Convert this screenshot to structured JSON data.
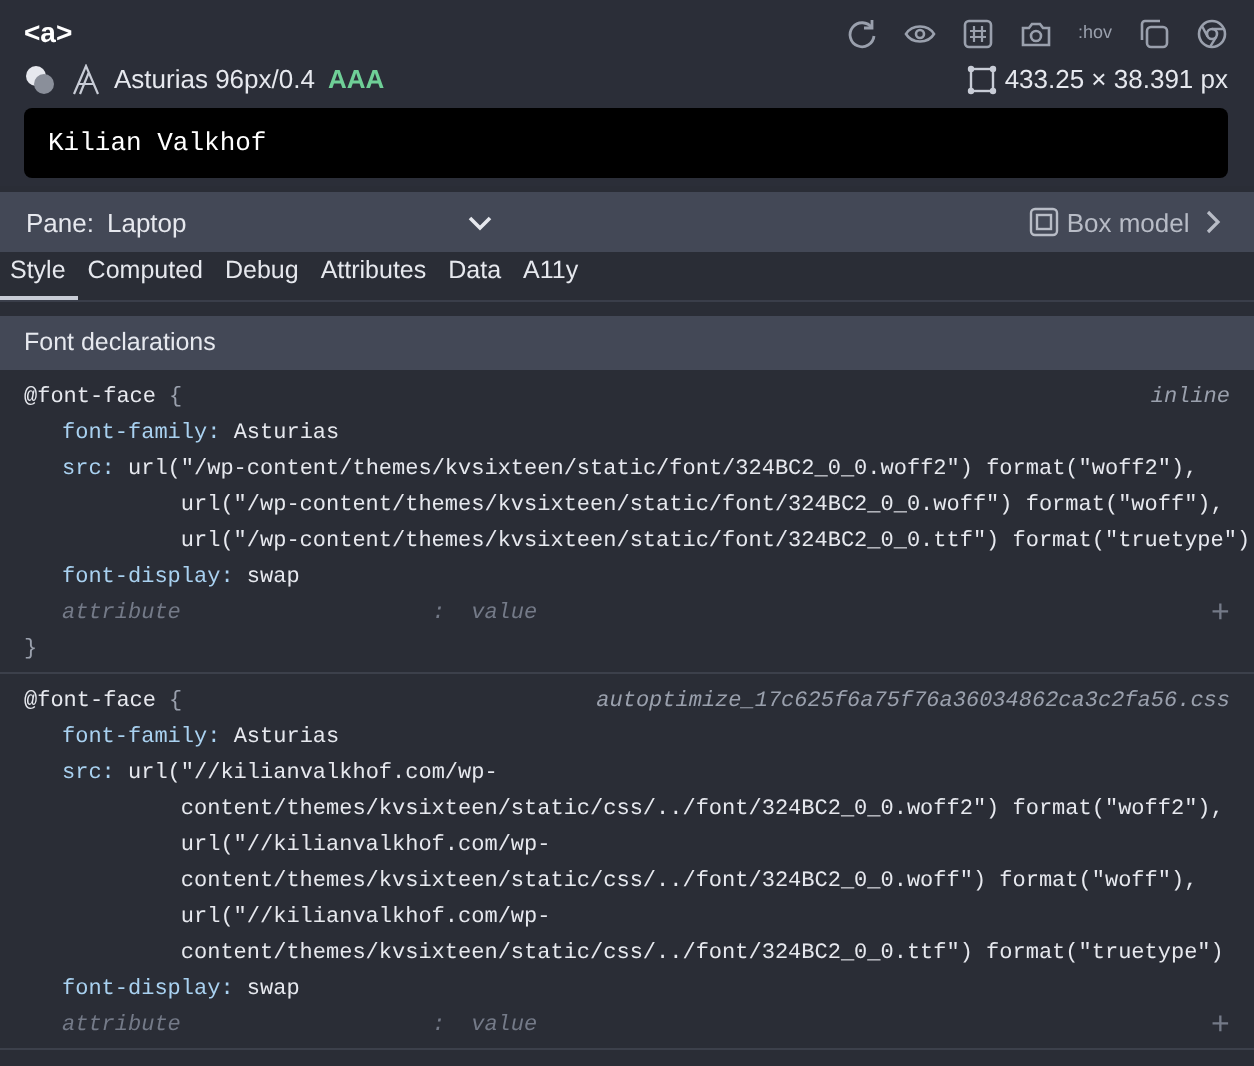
{
  "element": {
    "tag": "<a>",
    "font": "Asturias 96px/0.4",
    "contrast": "AAA",
    "size": "433.25 × 38.391 px",
    "preview": "Kilian Valkhof"
  },
  "toolbar": [
    {
      "kind": "refresh"
    },
    {
      "kind": "eye"
    },
    {
      "kind": "hash"
    },
    {
      "kind": "camera"
    },
    {
      "kind": "text",
      "label": ":hov"
    },
    {
      "kind": "copy"
    },
    {
      "kind": "chrome"
    }
  ],
  "pane": {
    "label": "Pane:",
    "value": "Laptop",
    "box_model": "Box model"
  },
  "tabs": [
    {
      "label": "Style",
      "selected": true
    },
    {
      "label": "Computed",
      "selected": false
    },
    {
      "label": "Debug",
      "selected": false
    },
    {
      "label": "Attributes",
      "selected": false
    },
    {
      "label": "Data",
      "selected": false
    },
    {
      "label": "A11y",
      "selected": false
    }
  ],
  "section": "Font declarations",
  "rules": [
    {
      "selector": "@font-face",
      "brace_open": "{",
      "source": "inline",
      "declarations": [
        {
          "property": "font-family:",
          "value_lines": [
            "Asturias"
          ]
        },
        {
          "property": "src:",
          "value_lines": [
            "url(\"/wp-content/themes/kvsixteen/static/font/324BC2_0_0.woff2\") format(\"woff2\"),",
            "url(\"/wp-content/themes/kvsixteen/static/font/324BC2_0_0.woff\") format(\"woff\"),",
            "url(\"/wp-content/themes/kvsixteen/static/font/324BC2_0_0.ttf\") format(\"truetype\")"
          ]
        },
        {
          "property": "font-display:",
          "value_lines": [
            "swap"
          ]
        }
      ],
      "new_attribute": {
        "placeholder": "attribute",
        "separator": ":",
        "value_placeholder": "value",
        "plus": "+"
      },
      "brace_close": "}"
    },
    {
      "selector": "@font-face",
      "brace_open": "{",
      "source": "autoptimize_17c625f6a75f76a36034862ca3c2fa56.css",
      "declarations": [
        {
          "property": "font-family:",
          "value_lines": [
            "Asturias"
          ]
        },
        {
          "property": "src:",
          "value_lines": [
            "url(\"//kilianvalkhof.com/wp-",
            "content/themes/kvsixteen/static/css/../font/324BC2_0_0.woff2\") format(\"woff2\"),",
            "url(\"//kilianvalkhof.com/wp-",
            "content/themes/kvsixteen/static/css/../font/324BC2_0_0.woff\") format(\"woff\"),",
            "url(\"//kilianvalkhof.com/wp-",
            "content/themes/kvsixteen/static/css/../font/324BC2_0_0.ttf\") format(\"truetype\")"
          ]
        },
        {
          "property": "font-display:",
          "value_lines": [
            "swap"
          ]
        }
      ],
      "new_attribute": {
        "placeholder": "attribute",
        "separator": ":",
        "value_placeholder": "value",
        "plus": "+"
      }
    }
  ]
}
